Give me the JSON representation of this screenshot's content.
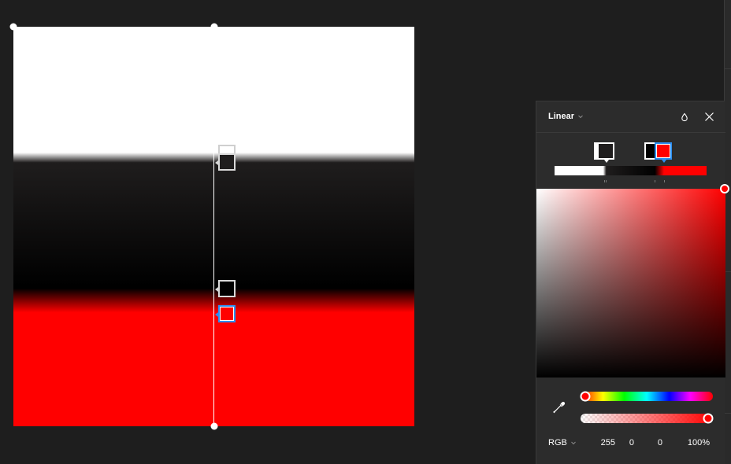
{
  "canvas": {
    "gradient_stops": [
      {
        "color": "#FFFFFF",
        "position_pct": 32
      },
      {
        "color": "#1F1D1D",
        "position_pct": 34
      },
      {
        "color": "#000000",
        "position_pct": 66
      },
      {
        "color": "#FF0000",
        "position_pct": 72
      }
    ],
    "selected_stop_index": 3
  },
  "panel": {
    "fill_type": "Linear",
    "icons": {
      "type_chevron": "chevron-down-icon",
      "style": "drop-icon",
      "close": "close-icon",
      "eyedropper": "eyedropper-icon",
      "mode_chevron": "chevron-down-icon"
    },
    "stop_swatches": [
      {
        "color": "#1F1D1D",
        "selected": false
      },
      {
        "color": "#000000",
        "selected": false
      },
      {
        "color": "#FF0000",
        "selected": true
      }
    ],
    "picker": {
      "hue_deg": 0,
      "saturation_pct": 100,
      "brightness_pct": 100,
      "alpha_pct": 100
    },
    "color_mode": "RGB",
    "values": {
      "r": "255",
      "g": "0",
      "b": "0",
      "a": "100%"
    },
    "colors": {
      "selected_accent": "#2D8EF0",
      "panel_bg": "#2C2C2C",
      "canvas_bg": "#1E1E1E"
    }
  }
}
